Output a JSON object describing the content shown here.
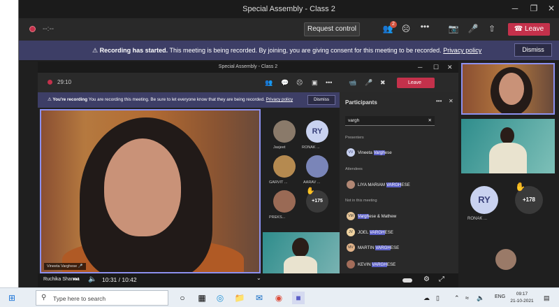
{
  "window": {
    "title": "Special Assembly - Class 2",
    "minimize": "─",
    "maximize": "❐",
    "close": "✕"
  },
  "toolbar": {
    "timer": "--:--",
    "request_control": "Request control",
    "people_badge": "2",
    "leave": "Leave"
  },
  "banner": {
    "bold": "Recording has started.",
    "text": "This meeting is being recorded. By joining, you are giving consent for this meeting to be recorded.",
    "link": "Privacy policy",
    "dismiss": "Dismiss"
  },
  "inner": {
    "title": "Special Assembly - Class 2",
    "timer": "29:10",
    "people_badge": "1",
    "leave": "Leave",
    "banner_bold": "You're recording",
    "banner_text": "You are recording this meeting. Be sure to let everyone know that they are being recorded.",
    "banner_link": "Privacy policy",
    "banner_dismiss": "Dismiss",
    "speaker_name": "Vineeta Varghese",
    "tiles": [
      {
        "label": "Jasjeet"
      },
      {
        "label": "RONAK ...",
        "initials": "RY"
      },
      {
        "label": "GARVIT ..."
      },
      {
        "label": "AARAV ..."
      },
      {
        "label": "PREKS..."
      },
      {
        "label": "+175"
      }
    ],
    "participants": {
      "title": "Participants",
      "search_value": "vargh",
      "presenters_label": "Presenters",
      "attendees_label": "Attendees",
      "not_in_meeting_label": "Not in this meeting",
      "presenters": [
        {
          "avatar": "VV",
          "pre": "Vineeta ",
          "hl": "Vargh",
          "post": "ese"
        }
      ],
      "attendees": [
        {
          "avatar": "",
          "pre": "LIYA MARIAM ",
          "hl": "VARGH",
          "post": "ESE"
        }
      ],
      "not_in_meeting": [
        {
          "avatar": "VM",
          "pre": "",
          "hl": "Vargh",
          "post": "ese & Mathew"
        },
        {
          "avatar": "JV",
          "pre": "JOEL ",
          "hl": "VARGH",
          "post": "ESE"
        },
        {
          "avatar": "MV",
          "pre": "MARTIN ",
          "hl": "VARGH",
          "post": "ESE"
        },
        {
          "avatar": "",
          "pre": "KEVIN ",
          "hl": "VARGH",
          "post": "ESE"
        }
      ]
    }
  },
  "video_controls": {
    "owner": "Ruchika Sharma",
    "time": "10:31 / 10:42"
  },
  "side": {
    "ry_initials": "RY",
    "ry_label": "RONAK ...",
    "plus_count": "+178"
  },
  "taskbar": {
    "search_placeholder": "Type here to search",
    "lang": "ENG",
    "time": "09:17",
    "date": "21-10-2021"
  }
}
